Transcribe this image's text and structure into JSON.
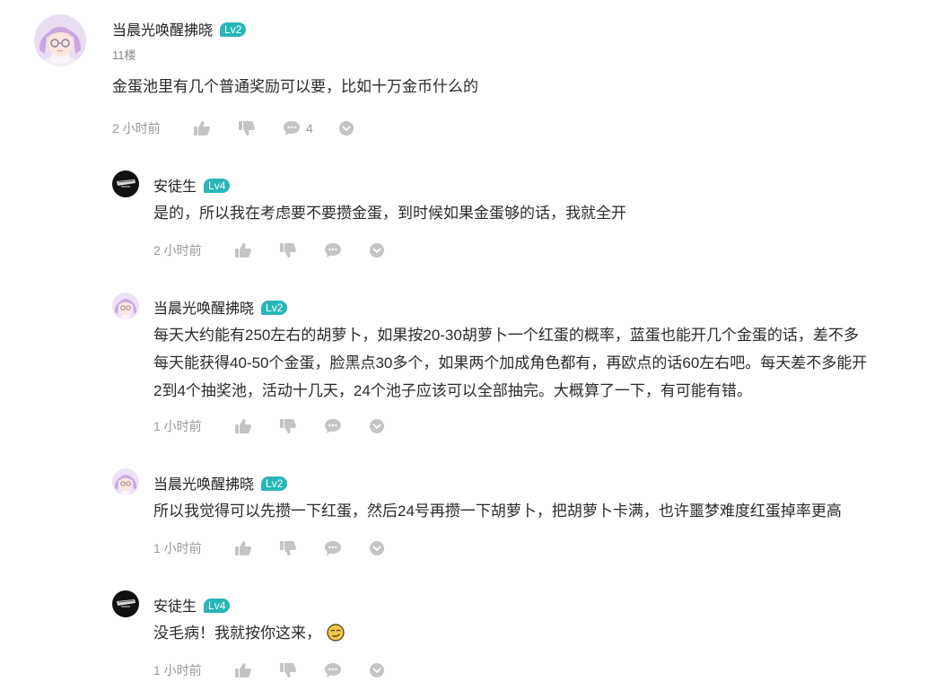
{
  "main_comment": {
    "user": "当晨光唤醒拂晓",
    "level": "Lv2",
    "floor": "11楼",
    "content": "金蛋池里有几个普通奖励可以要，比如十万金币什么的",
    "time": "2 小时前",
    "reply_count": "4"
  },
  "replies": [
    {
      "user": "安徒生",
      "level": "Lv4",
      "lines": [
        "是的，所以我在考虑要不要攒金蛋，到时候如果金蛋够的话，我就全开"
      ],
      "time": "2 小时前"
    },
    {
      "user": "当晨光唤醒拂晓",
      "level": "Lv2",
      "lines": [
        "每天大约能有250左右的胡萝卜，如果按20-30胡萝卜一个红蛋的概率，蓝蛋也能开几个金蛋的话，差不多",
        "每天能获得40-50个金蛋，脸黑点30多个，如果两个加成角色都有，再欧点的话60左右吧。每天差不多能开",
        "2到4个抽奖池，活动十几天，24个池子应该可以全部抽完。大概算了一下，有可能有错。"
      ],
      "time": "1 小时前"
    },
    {
      "user": "当晨光唤醒拂晓",
      "level": "Lv2",
      "lines": [
        "所以我觉得可以先攒一下红蛋，然后24号再攒一下胡萝卜，把胡萝卜卡满，也许噩梦难度红蛋掉率更高"
      ],
      "time": "1 小时前"
    },
    {
      "user": "安徒生",
      "level": "Lv4",
      "lines": [
        "没毛病！我就按你这来，"
      ],
      "emoji": "smirk-emoji",
      "time": "1 小时前"
    }
  ],
  "colors": {
    "level_badge": "#28b6b6",
    "icon_gray": "#c4c4c4",
    "meta_text": "#999999"
  }
}
